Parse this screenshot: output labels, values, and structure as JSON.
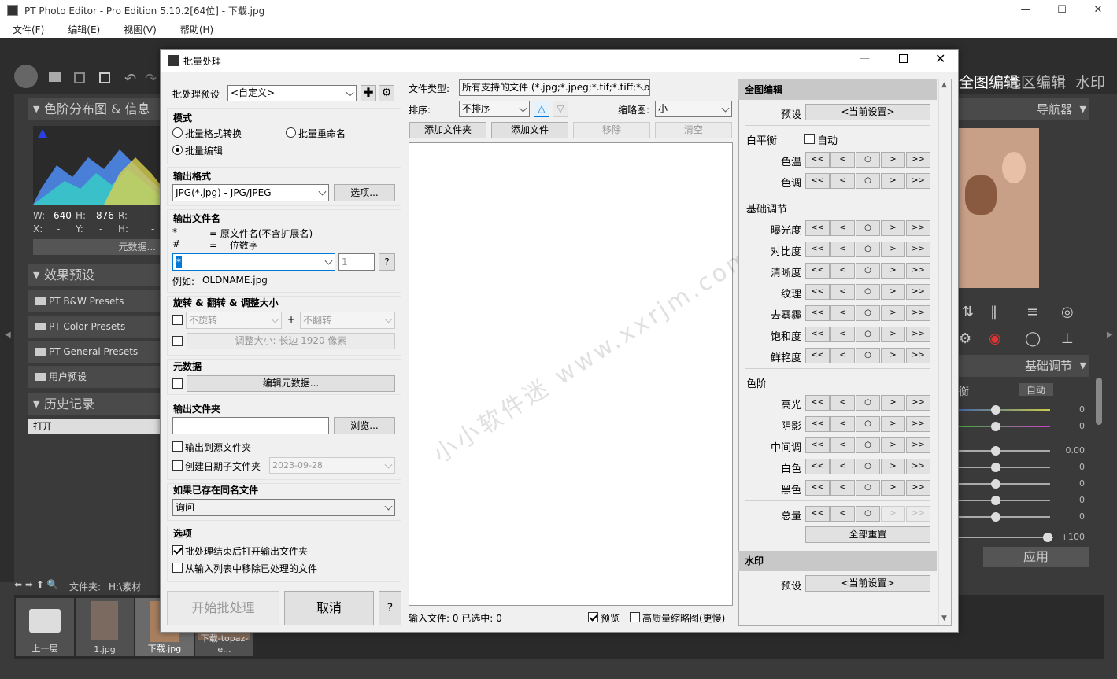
{
  "app": {
    "title": "PT Photo Editor - Pro Edition 5.10.2[64位] - 下载.jpg",
    "window_buttons": [
      "—",
      "☐",
      "✕"
    ],
    "menu": [
      "文件(F)",
      "编辑(E)",
      "视图(V)",
      "帮助(H)"
    ]
  },
  "main": {
    "top_tabs": [
      "全图编辑",
      "选区编辑",
      "水印"
    ],
    "histogram_title": "色阶分布图 & 信息",
    "info_w_label": "W:",
    "info_w": "640",
    "info_h_label": "H:",
    "info_h": "876",
    "info_r_label": "R:",
    "info_r": "-",
    "info_x_label": "X:",
    "info_x": "-",
    "info_y_label": "Y:",
    "info_y": "-",
    "info_h2_label": "H:",
    "info_h2": "-",
    "metadata_button": "元数据...",
    "presets_title": "效果预设",
    "presets": [
      "PT B&W Presets",
      "PT Color Presets",
      "PT General Presets",
      "用户预设"
    ],
    "history_title": "历史记录",
    "history_items": [
      "打开"
    ],
    "navigator_title": "导航器",
    "basic_adjust_title": "基础调节",
    "wb_partial_label": "衡",
    "auto_button": "自动",
    "slider_values": [
      "0",
      "0",
      "0.00",
      "0",
      "0",
      "0",
      "0",
      "+100"
    ],
    "apply_button": "应用",
    "folder_label": "文件夹:",
    "folder_path": "H:\\素材",
    "filmstrip": [
      "上一层",
      "1.jpg",
      "下载.jpg",
      "下载-topaz-e..."
    ]
  },
  "dialog": {
    "title": "批量处理",
    "preset_label": "批处理预设",
    "preset_value": "<自定义>",
    "mode_title": "模式",
    "mode_options": [
      "批量格式转换",
      "批量重命名",
      "批量编辑"
    ],
    "mode_selected": 2,
    "output_format_title": "输出格式",
    "output_format_value": "JPG(*.jpg) - JPG/JPEG",
    "options_button": "选项...",
    "output_filename_title": "输出文件名",
    "name_rule1_key": "*",
    "name_rule1_desc": "= 原文件名(不含扩展名)",
    "name_rule2_key": "#",
    "name_rule2_desc": "= 一位数字",
    "name_pattern": "*",
    "start_number": "1",
    "help_button": "?",
    "example_label": "例如:",
    "example_value": "OLDNAME.jpg",
    "rotate_title": "旋转 & 翻转 & 调整大小",
    "rotate_value": "不旋转",
    "plus": "+",
    "flip_value": "不翻转",
    "resize_button": "调整大小: 长边 1920 像素",
    "metadata_title": "元数据",
    "edit_metadata_button": "编辑元数据...",
    "output_folder_title": "输出文件夹",
    "output_folder_value": "",
    "browse_button": "浏览...",
    "output_to_source": "输出到源文件夹",
    "create_date_folder": "创建日期子文件夹",
    "date_value": "2023-09-28",
    "exists_title": "如果已存在同名文件",
    "exists_value": "询问",
    "options_title": "选项",
    "open_folder_after": "批处理结束后打开输出文件夹",
    "remove_processed": "从输入列表中移除已处理的文件",
    "start_button": "开始批处理",
    "cancel_button": "取消",
    "question_button": "?",
    "file_type_label": "文件类型:",
    "file_type_value": "所有支持的文件 (*.jpg;*.jpeg;*.tif;*.tiff;*.b",
    "sort_label": "排序:",
    "sort_value": "不排序",
    "thumb_label": "缩略图:",
    "thumb_value": "小",
    "add_folder_button": "添加文件夹",
    "add_file_button": "添加文件",
    "remove_button": "移除",
    "clear_button": "清空",
    "status_text": "输入文件: 0  已选中: 0",
    "preview_label": "预览",
    "hq_thumb_label": "高质量缩略图(更慢)",
    "watermark": "小小软件迷 www.xxrjm.com",
    "right": {
      "global_title": "全图编辑",
      "preset_label": "预设",
      "current_setting": "<当前设置>",
      "wb_title": "白平衡",
      "auto_label": "自动",
      "wb_items": [
        "色温",
        "色调"
      ],
      "basic_title": "基础调节",
      "basic_items": [
        "曝光度",
        "对比度",
        "清晰度",
        "纹理",
        "去雾霾",
        "饱和度",
        "鲜艳度"
      ],
      "levels_title": "色阶",
      "levels_items": [
        "高光",
        "阴影",
        "中间调",
        "白色",
        "黑色"
      ],
      "total_label": "总量",
      "reset_all_button": "全部重置",
      "watermark_title": "水印",
      "watermark_preset_label": "预设",
      "watermark_current": "<当前设置>",
      "step_buttons": [
        "<<",
        "<",
        "○",
        ">",
        ">>"
      ]
    }
  }
}
